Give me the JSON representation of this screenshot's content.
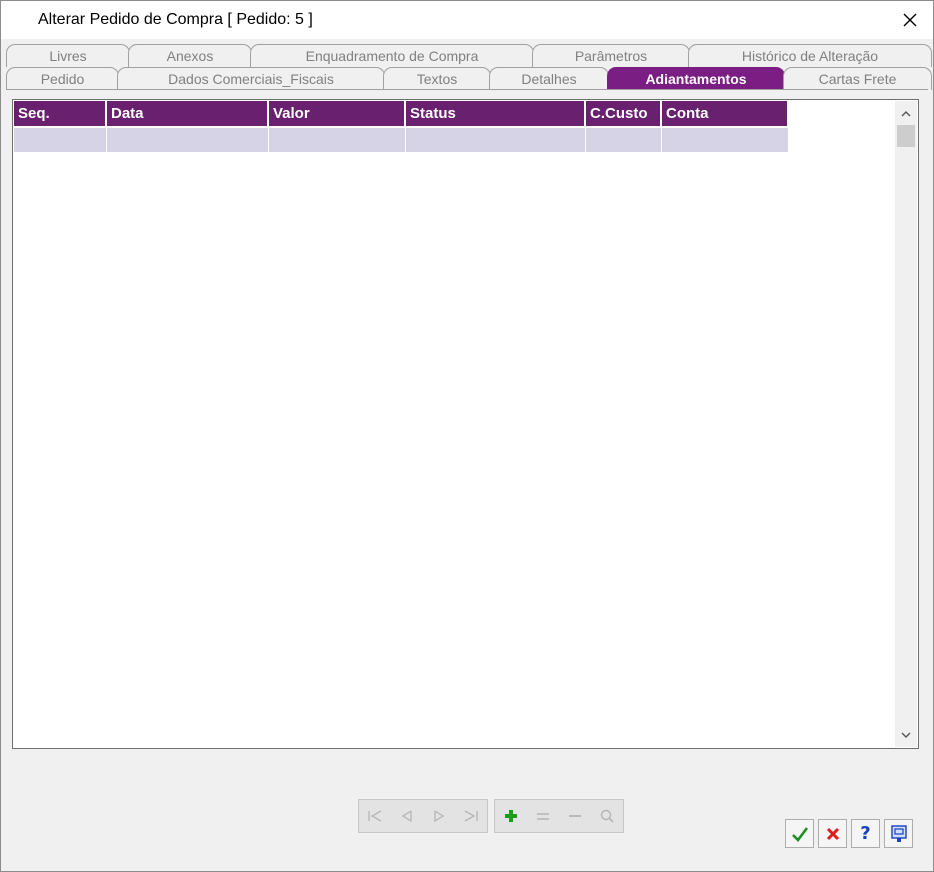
{
  "window": {
    "title": "Alterar Pedido de Compra [ Pedido: 5 ]"
  },
  "tabs": {
    "top_row": [
      "Livres",
      "Anexos",
      "Enquadramento de Compra",
      "Parâmetros",
      "Histórico de Alteração"
    ],
    "bottom_row": [
      "Pedido",
      "Dados Comerciais_Fiscais",
      "Textos",
      "Detalhes",
      "Adiantamentos",
      "Cartas Frete"
    ],
    "active": "Adiantamentos"
  },
  "grid": {
    "columns": [
      "Seq.",
      "Data",
      "Valor",
      "Status",
      "C.Custo",
      "Conta"
    ],
    "rows": [
      [
        "",
        "",
        "",
        "",
        "",
        ""
      ]
    ]
  },
  "navigator": {
    "buttons": [
      "first-icon",
      "prior-icon",
      "next-icon",
      "last-icon",
      "insert-icon",
      "edit-icon",
      "delete-icon",
      "search-icon"
    ]
  },
  "actions": {
    "buttons": [
      "ok-icon",
      "cancel-icon",
      "help-icon",
      "print-icon"
    ],
    "help_label": "?"
  },
  "colors": {
    "accent": "#7a1e84",
    "header": "#68206f",
    "row": "#d7d3e6"
  }
}
